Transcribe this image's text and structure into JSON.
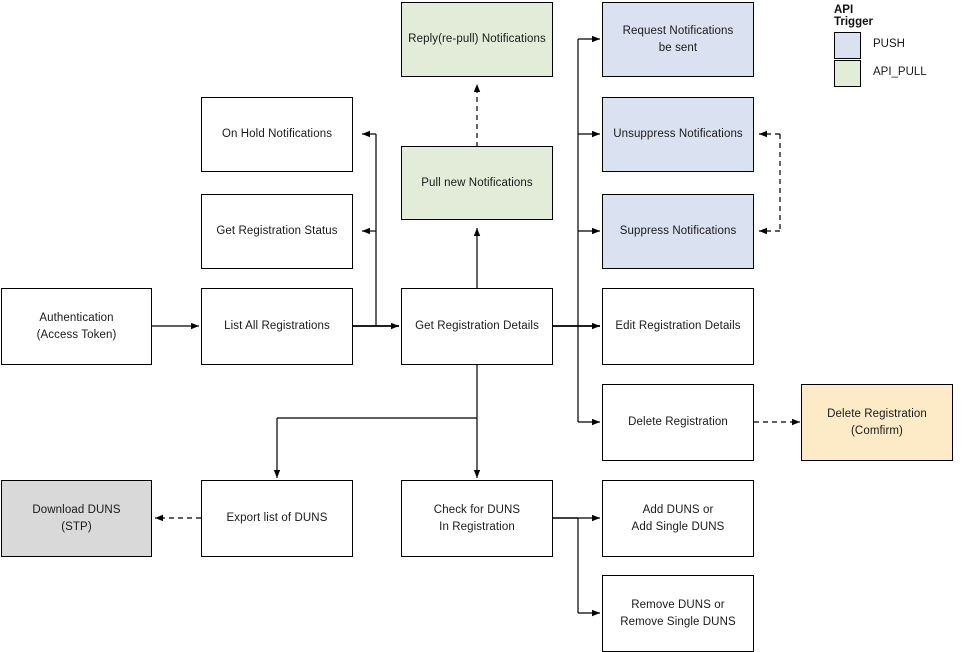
{
  "legend": {
    "title": "API Trigger",
    "items": [
      {
        "label": "PUSH",
        "color": "#dae1f1"
      },
      {
        "label": "API_PULL",
        "color": "#e3ebd9"
      }
    ]
  },
  "nodes": {
    "authentication": {
      "line1": "Authentication",
      "line2": "(Access Token)"
    },
    "list_all_registrations": {
      "line1": "List All Registrations"
    },
    "on_hold_notifications": {
      "line1": "On Hold Notifications"
    },
    "get_registration_status": {
      "line1": "Get Registration Status"
    },
    "get_registration_details": {
      "line1": "Get Registration Details"
    },
    "reply_repull_notifications": {
      "line1": "Reply(re-pull) Notifications"
    },
    "pull_new_notifications": {
      "line1": "Pull new Notifications"
    },
    "request_notifications_be_sent": {
      "line1": "Request Notifications",
      "line2": "be sent"
    },
    "unsuppress_notifications": {
      "line1": "Unsuppress Notifications"
    },
    "suppress_notifications": {
      "line1": "Suppress Notifications"
    },
    "edit_registration_details": {
      "line1": "Edit Registration Details"
    },
    "delete_registration": {
      "line1": "Delete Registration"
    },
    "delete_registration_confirm": {
      "line1": "Delete Registration",
      "line2": "(Comfirm)"
    },
    "download_duns_stp": {
      "line1": "Download DUNS",
      "line2": "(STP)"
    },
    "export_list_of_duns": {
      "line1": "Export list of DUNS"
    },
    "check_for_duns_in_registration": {
      "line1": "Check for DUNS",
      "line2": "In Registration"
    },
    "add_duns": {
      "line1": "Add DUNS or",
      "line2": "Add Single DUNS"
    },
    "remove_duns": {
      "line1": "Remove DUNS or",
      "line2": "Remove Single DUNS"
    }
  },
  "colors": {
    "push": "#dae1f1",
    "api_pull": "#e3ebd9",
    "confirm": "#fdeac7",
    "stp": "#d9d9d9",
    "border": "#000000",
    "background": "#ffffff"
  }
}
